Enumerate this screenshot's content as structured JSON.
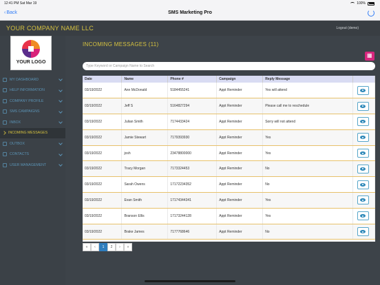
{
  "status": {
    "time": "12:41 PM",
    "date": "Sat Mar 19",
    "battery": "100%"
  },
  "nav": {
    "back": "Back",
    "title": "SMS Marketing Pro"
  },
  "header": {
    "company": "YOUR COMPANY NAME LLC",
    "logout": "Logout (demo)"
  },
  "logo": {
    "text": "YOUR LOGO"
  },
  "sidebar": {
    "items": [
      {
        "label": "MY DASHBOARD"
      },
      {
        "label": "HELP INFORMATION"
      },
      {
        "label": "COMPANY PROFILE"
      },
      {
        "label": "SMS CAMPAIGNS"
      },
      {
        "label": "INBOX"
      },
      {
        "label": "INCOMING MESSAGES"
      },
      {
        "label": "OUTBOX"
      },
      {
        "label": "CONTACTS"
      },
      {
        "label": "USER MANAGEMENT"
      }
    ]
  },
  "main": {
    "title": "INCOMING MESSAGES (11)",
    "search_placeholder": "Type Keyword or Campaign Name to Search",
    "columns": [
      "Date",
      "Name",
      "Phone #",
      "Campaign",
      "Reply Message",
      ""
    ],
    "rows": [
      {
        "date": "03/19/2022",
        "name": "Ann McDonald",
        "phone": "5184455241",
        "campaign": "Appt Reminder",
        "reply": "Yes will attend"
      },
      {
        "date": "03/19/2022",
        "name": "Jeff S",
        "phone": "5164827294",
        "campaign": "Appt Reminder",
        "reply": "Please call me to reschedule"
      },
      {
        "date": "03/19/2022",
        "name": "Julian Smith",
        "phone": "7174433424",
        "campaign": "Appt Reminder",
        "reply": "Sorry will not attend"
      },
      {
        "date": "03/19/2022",
        "name": "Jamie Stewart",
        "phone": "7179393930",
        "campaign": "Appt Reminder",
        "reply": "Yes"
      },
      {
        "date": "03/19/2022",
        "name": "josh",
        "phone": "23478800000",
        "campaign": "Appt Reminder",
        "reply": "Yes"
      },
      {
        "date": "03/19/2022",
        "name": "Tracy Morgan",
        "phone": "7173324453",
        "campaign": "Appt Reminder",
        "reply": "No"
      },
      {
        "date": "03/19/2022",
        "name": "Sarah Owens",
        "phone": "17172234352",
        "campaign": "Appt Reminder",
        "reply": "No"
      },
      {
        "date": "03/19/2022",
        "name": "Evan Smith",
        "phone": "17174344341",
        "campaign": "Appt Reminder",
        "reply": "Yes"
      },
      {
        "date": "03/19/2022",
        "name": "Branson Ellis",
        "phone": "17173244128",
        "campaign": "Appt Reminder",
        "reply": "Yes"
      },
      {
        "date": "03/19/2022",
        "name": "Brake James",
        "phone": "7177768646",
        "campaign": "Appt Reminder",
        "reply": "No"
      }
    ],
    "pager": [
      "«",
      "‹",
      "1",
      "2",
      "›",
      "»"
    ],
    "current_page": "1"
  }
}
